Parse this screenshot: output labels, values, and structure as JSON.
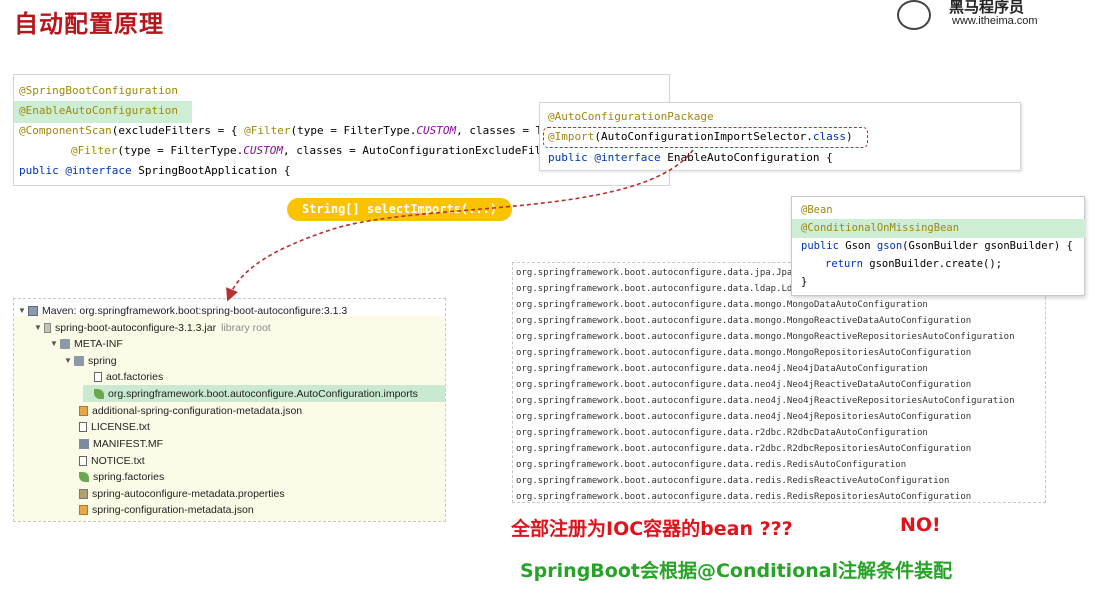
{
  "title": "自动配置原理",
  "logo": {
    "name": "黑马程序员",
    "url": "www.itheima.com"
  },
  "spring_boot_app": {
    "line1": "@SpringBootConfiguration",
    "line2": "@EnableAutoConfiguration",
    "line3_ann": "@ComponentScan",
    "line3_a": "(excludeFilters = { ",
    "line3_b": "@Filter",
    "line3_c": "(type = FilterType.",
    "line3_d": "CUSTOM",
    "line3_e": ", classes = T",
    "line4_b": "@Filter",
    "line4_c": "(type = FilterType.",
    "line4_d": "CUSTOM",
    "line4_e": ", classes = AutoConfigurationExcludeFil",
    "line5_kw": "public",
    "line5_ann": " @interface",
    "line5_rest": " SpringBootApplication {"
  },
  "enable_auto": {
    "line1": "@AutoConfigurationPackage",
    "line2_ann": "@Import",
    "line2_a": "(AutoConfigurationImportSelector.",
    "line2_kw": "class",
    "line2_b": ")",
    "line3_kw": "public",
    "line3_ann": " @interface",
    "line3_rest": " EnableAutoConfiguration {"
  },
  "select_imports": "String[] selectImports(...)",
  "gson_bean": {
    "line1": "@Bean",
    "line2": "@ConditionalOnMissingBean",
    "line3_kw": "public",
    "line3_a": " Gson ",
    "line3_m": "gson",
    "line3_b": "(GsonBuilder gsonBuilder) {",
    "line4_kw": "return",
    "line4_a": " gsonBuilder.create();",
    "line5": "}"
  },
  "tree": {
    "nodes": [
      {
        "label": "Maven: org.springframework.boot:spring-boot-autoconfigure:3.1.3",
        "icon": "library-icon"
      },
      {
        "label": "spring-boot-autoconfigure-3.1.3.jar",
        "muted": "library root",
        "icon": "jar-icon"
      },
      {
        "label": "META-INF",
        "icon": "folder-icon"
      },
      {
        "label": "spring",
        "icon": "folder-icon"
      },
      {
        "label": "aot.factories",
        "icon": "file-icon"
      },
      {
        "label": "org.springframework.boot.autoconfigure.AutoConfiguration.imports",
        "icon": "spring-leaf-icon"
      },
      {
        "label": "additional-spring-configuration-metadata.json",
        "icon": "json-icon"
      },
      {
        "label": "LICENSE.txt",
        "icon": "file-icon"
      },
      {
        "label": "MANIFEST.MF",
        "icon": "manifest-icon"
      },
      {
        "label": "NOTICE.txt",
        "icon": "file-icon"
      },
      {
        "label": "spring.factories",
        "icon": "spring-leaf-icon"
      },
      {
        "label": "spring-autoconfigure-metadata.properties",
        "icon": "properties-icon"
      },
      {
        "label": "spring-configuration-metadata.json",
        "icon": "json-icon"
      }
    ]
  },
  "imports_list": [
    "org.springframework.boot.autoconfigure.data.jpa.JpaR",
    "org.springframework.boot.autoconfigure.data.ldap.Lda",
    "org.springframework.boot.autoconfigure.data.mongo.MongoDataAutoConfiguration",
    "org.springframework.boot.autoconfigure.data.mongo.MongoReactiveDataAutoConfiguration",
    "org.springframework.boot.autoconfigure.data.mongo.MongoReactiveRepositoriesAutoConfiguration",
    "org.springframework.boot.autoconfigure.data.mongo.MongoRepositoriesAutoConfiguration",
    "org.springframework.boot.autoconfigure.data.neo4j.Neo4jDataAutoConfiguration",
    "org.springframework.boot.autoconfigure.data.neo4j.Neo4jReactiveDataAutoConfiguration",
    "org.springframework.boot.autoconfigure.data.neo4j.Neo4jReactiveRepositoriesAutoConfiguration",
    "org.springframework.boot.autoconfigure.data.neo4j.Neo4jRepositoriesAutoConfiguration",
    "org.springframework.boot.autoconfigure.data.r2dbc.R2dbcDataAutoConfiguration",
    "org.springframework.boot.autoconfigure.data.r2dbc.R2dbcRepositoriesAutoConfiguration",
    "org.springframework.boot.autoconfigure.data.redis.RedisAutoConfiguration",
    "org.springframework.boot.autoconfigure.data.redis.RedisReactiveAutoConfiguration",
    "org.springframework.boot.autoconfigure.data.redis.RedisRepositoriesAutoConfiguration"
  ],
  "question": "全部注册为IOC容器的bean ???",
  "answer": "NO!",
  "conclusion": "SpringBoot会根据@Conditional注解条件装配",
  "colors": {
    "title": "#b5161c",
    "annotation": "#9e880d",
    "keyword": "#0033b3",
    "highlight": "#cdeed5",
    "pill": "#f9c300",
    "red_text": "#e0121c",
    "green_text": "#27a327",
    "dash_arrow": "#b83030"
  }
}
